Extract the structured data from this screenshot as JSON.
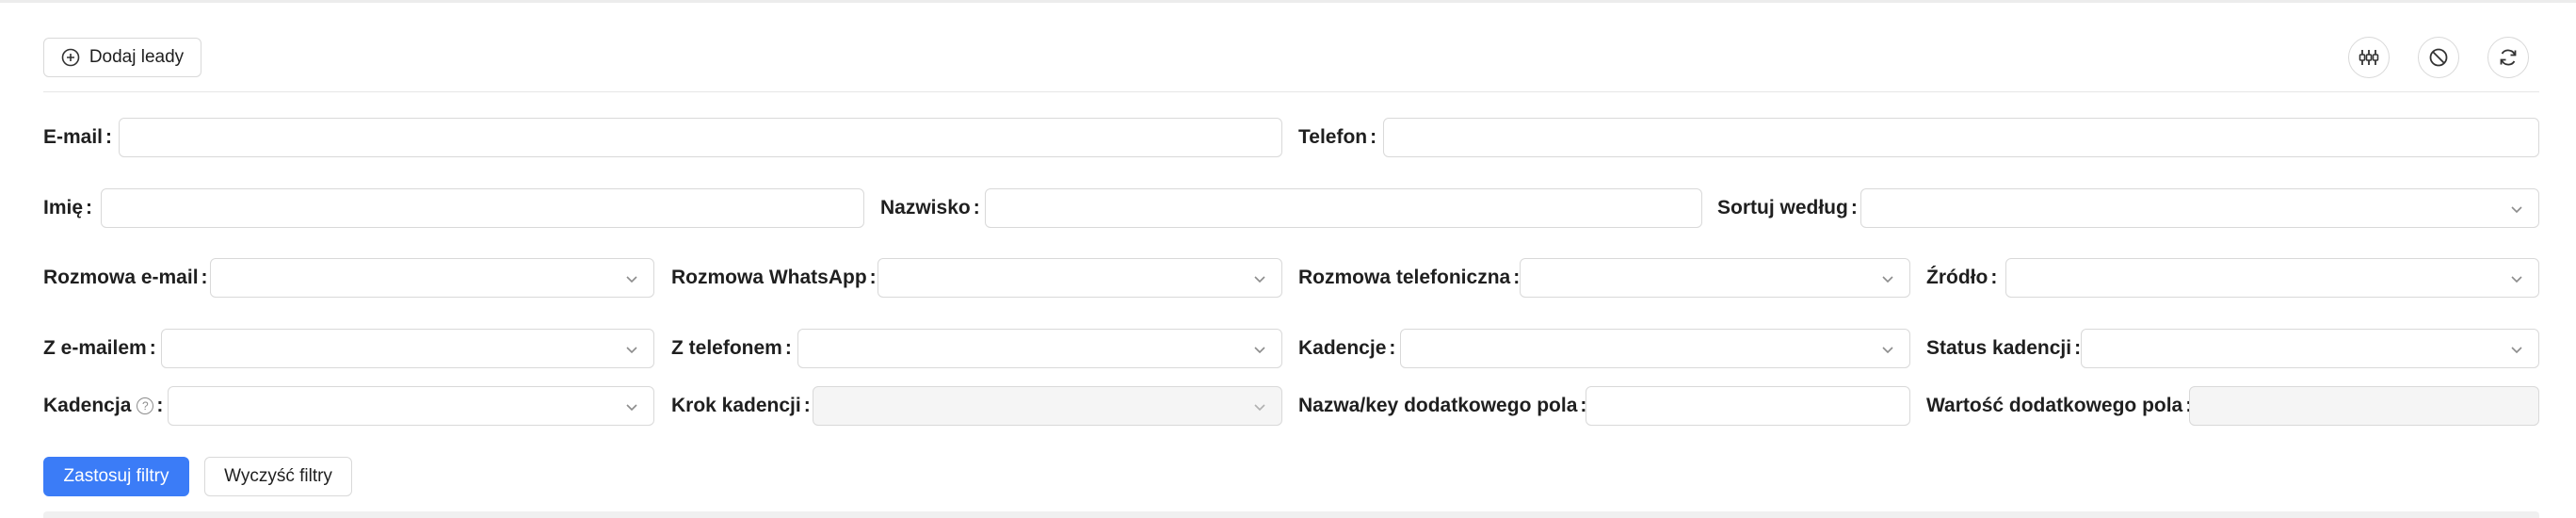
{
  "toolbar": {
    "add_leads_label": "Dodaj leady",
    "icons": [
      "columns-settings-icon",
      "block-icon",
      "refresh-icon"
    ]
  },
  "filters": {
    "email_label": "E-mail",
    "phone_label": "Telefon",
    "first_name_label": "Imię",
    "last_name_label": "Nazwisko",
    "sort_label": "Sortuj według",
    "email_conversation_label": "Rozmowa e-mail",
    "whatsapp_conversation_label": "Rozmowa WhatsApp",
    "phone_conversation_label": "Rozmowa telefoniczna",
    "source_label": "Źródło",
    "with_email_label": "Z e-mailem",
    "with_phone_label": "Z telefonem",
    "cadences_label": "Kadencje",
    "cadence_status_label": "Status kadencji",
    "cadence_label": "Kadencja",
    "cadence_help_glyph": "?",
    "cadence_step_label": "Krok kadencji",
    "custom_field_key_label": "Nazwa/key dodatkowego pola",
    "custom_field_value_label": "Wartość dodatkowego pola",
    "colon": ":"
  },
  "actions": {
    "apply_label": "Zastosuj filtry",
    "clear_label": "Wyczyść filtry"
  },
  "colors": {
    "primary": "#3b7cf7",
    "border": "#d9d9d9",
    "disabled_bg": "#f5f5f5"
  }
}
